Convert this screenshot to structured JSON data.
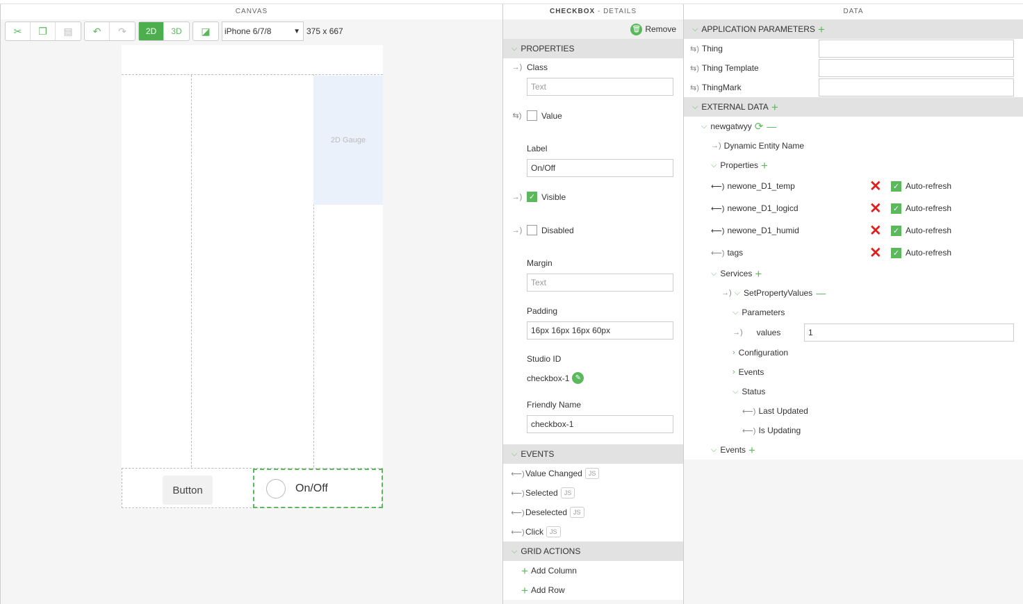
{
  "canvas": {
    "title": "CANVAS",
    "toolbar": {
      "mode_2d": "2D",
      "mode_3d": "3D",
      "device": "iPhone 6/7/8",
      "size": "375 x 667"
    },
    "gauge_label": "2D Gauge",
    "button_label": "Button",
    "checkbox_label": "On/Off"
  },
  "details": {
    "title_bold": "CHECKBOX",
    "title_rest": " - DETAILS",
    "remove_label": "Remove",
    "properties_header": "PROPERTIES",
    "class_label": "Class",
    "class_placeholder": "Text",
    "value_label": "Value",
    "label_label": "Label",
    "label_value": "On/Off",
    "visible_label": "Visible",
    "disabled_label": "Disabled",
    "margin_label": "Margin",
    "margin_placeholder": "Text",
    "padding_label": "Padding",
    "padding_value": "16px 16px 16px 60px",
    "studio_id_label": "Studio ID",
    "studio_id_value": "checkbox-1",
    "friendly_name_label": "Friendly Name",
    "friendly_name_value": "checkbox-1",
    "events_header": "EVENTS",
    "events": [
      "Value Changed",
      "Selected",
      "Deselected",
      "Click"
    ],
    "js_label": "JS",
    "grid_actions_header": "GRID ACTIONS",
    "grid_actions": [
      "Add Column",
      "Add Row"
    ]
  },
  "data": {
    "title": "DATA",
    "app_params_header": "APPLICATION PARAMETERS",
    "app_params": [
      "Thing",
      "Thing Template",
      "ThingMark"
    ],
    "external_header": "EXTERNAL DATA",
    "entity": "newgatwyy",
    "dynamic_entity": "Dynamic Entity Name",
    "properties_label": "Properties",
    "properties": [
      "newone_D1_temp",
      "newone_D1_logicd",
      "newone_D1_humid",
      "tags"
    ],
    "auto_refresh": "Auto-refresh",
    "services_label": "Services",
    "service": "SetPropertyValues",
    "parameters_label": "Parameters",
    "values_label": "values",
    "values_value": "1",
    "configuration_label": "Configuration",
    "events_label": "Events",
    "status_label": "Status",
    "last_updated": "Last Updated",
    "is_updating": "Is Updating",
    "bottom_events": "Events"
  }
}
